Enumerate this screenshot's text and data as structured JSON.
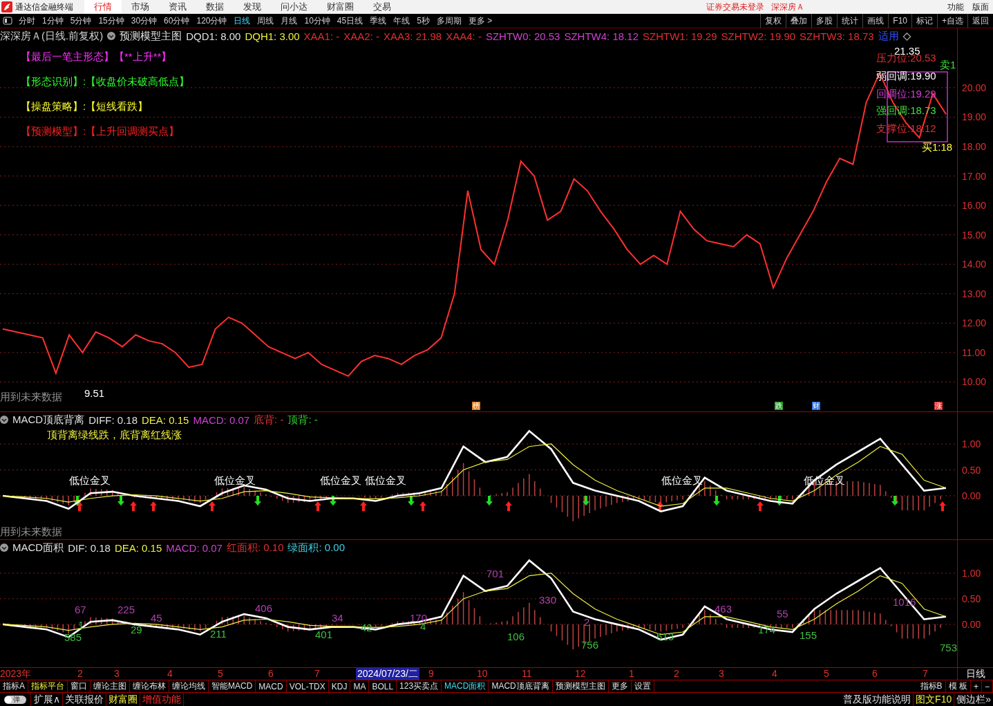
{
  "app": {
    "title": "通达信金融终端",
    "nav": [
      {
        "label": "行情",
        "selected": true
      },
      {
        "label": "市场",
        "selected": false
      },
      {
        "label": "资讯",
        "selected": false
      },
      {
        "label": "数据",
        "selected": false
      },
      {
        "label": "发现",
        "selected": false
      },
      {
        "label": "问小达",
        "selected": false
      },
      {
        "label": "财富圈",
        "selected": false
      },
      {
        "label": "交易",
        "selected": false
      }
    ],
    "login_status": "证券交易未登录",
    "stock": "深深房Ａ",
    "right_menu": [
      "功能",
      "版面"
    ]
  },
  "toolbar": {
    "periods": [
      {
        "label": "分时",
        "selected": false
      },
      {
        "label": "1分钟",
        "selected": false
      },
      {
        "label": "5分钟",
        "selected": false
      },
      {
        "label": "15分钟",
        "selected": false
      },
      {
        "label": "30分钟",
        "selected": false
      },
      {
        "label": "60分钟",
        "selected": false
      },
      {
        "label": "120分钟",
        "selected": false
      },
      {
        "label": "日线",
        "selected": true
      },
      {
        "label": "周线",
        "selected": false
      },
      {
        "label": "月线",
        "selected": false
      },
      {
        "label": "10分钟",
        "selected": false
      },
      {
        "label": "45日线",
        "selected": false
      },
      {
        "label": "季线",
        "selected": false
      },
      {
        "label": "年线",
        "selected": false
      },
      {
        "label": "5秒",
        "selected": false
      },
      {
        "label": "多周期",
        "selected": false
      },
      {
        "label": "更多 >",
        "selected": false
      }
    ],
    "actions": [
      "复权",
      "叠加",
      "多股",
      "统计",
      "画线",
      "F10",
      "标记",
      "+自选",
      "返回"
    ]
  },
  "price_panel": {
    "header": [
      {
        "text": "深深房Ａ(日线.前复权)",
        "color": "#d0d0d0"
      },
      {
        "text": "预测模型主图",
        "color": "#e0e0e0"
      },
      {
        "text": "DQD1: 8.00",
        "color": "#e0e0e0"
      },
      {
        "text": "DQH1: 3.00",
        "color": "#f0f040"
      },
      {
        "text": "XAA1: -",
        "color": "#e03030"
      },
      {
        "text": "XAA2: -",
        "color": "#e03030"
      },
      {
        "text": "XAA3: 21.98",
        "color": "#e03030"
      },
      {
        "text": "XAA4: -",
        "color": "#e03030"
      },
      {
        "text": "SZHTW0: 20.53",
        "color": "#d040d0"
      },
      {
        "text": "SZHTW4: 18.12",
        "color": "#d040d0"
      },
      {
        "text": "SZHTW1: 19.29",
        "color": "#e03030"
      },
      {
        "text": "SZHTW2: 19.90",
        "color": "#e03030"
      },
      {
        "text": "SZHTW3: 18.73",
        "color": "#e03030"
      },
      {
        "text": "适用",
        "color": "#3050ff"
      }
    ],
    "header_glyph": "◇",
    "signals": [
      {
        "text": "【最后一笔主形态】【**上升**】",
        "color": "#ff30ff"
      },
      {
        "text": "【形态识别】:【收盘价未破高低点】",
        "color": "#30ff30"
      },
      {
        "text": "【操盘策略】:【短线看跌】",
        "color": "#ffff30"
      },
      {
        "text": "【预测模型】:【上升回调测买点】",
        "color": "#ff2020"
      }
    ],
    "levels": [
      {
        "text": "压力位:20.53",
        "color": "#e03030"
      },
      {
        "text": "弱回调:19.90",
        "color": "#ffffff"
      },
      {
        "text": "回调位:19.29",
        "color": "#d040d0"
      },
      {
        "text": "强回调:18.73",
        "color": "#40e040"
      },
      {
        "text": "支撑位:18.12",
        "color": "#e03030"
      }
    ],
    "high_mark": "21.35",
    "low_mark": "9.51",
    "sell_mark": "卖1",
    "buy_mark": "买1:18",
    "future_note": "用到未来数据",
    "events": [
      {
        "text": "榜",
        "color": "#e08020"
      },
      {
        "text": "跌",
        "color": "#30a030"
      },
      {
        "text": "财",
        "color": "#3070e0"
      },
      {
        "text": "涨",
        "color": "#e03030"
      }
    ],
    "chart_data": {
      "type": "line",
      "grid": true,
      "ylim": [
        9,
        21.5
      ],
      "yticks": [
        {
          "value": 10,
          "label": "10.00"
        },
        {
          "value": 11,
          "label": "11.00"
        },
        {
          "value": 12,
          "label": "12.00"
        },
        {
          "value": 13,
          "label": "13.00"
        },
        {
          "value": 14,
          "label": "14.00"
        },
        {
          "value": 15,
          "label": "15.00"
        },
        {
          "value": 16,
          "label": "16.00"
        },
        {
          "value": 17,
          "label": "17.00"
        },
        {
          "value": 18,
          "label": "18.00"
        },
        {
          "value": 19,
          "label": "19.00"
        },
        {
          "value": 20,
          "label": "20.00"
        }
      ],
      "series": [
        {
          "color": "#ff3030",
          "values": [
            11.8,
            11.7,
            11.6,
            11.5,
            10.3,
            11.6,
            11.0,
            11.7,
            11.5,
            11.2,
            11.6,
            11.4,
            11.3,
            11.0,
            10.5,
            10.6,
            11.8,
            12.2,
            12.0,
            11.6,
            11.2,
            11.0,
            10.8,
            11.0,
            10.6,
            10.4,
            10.2,
            10.7,
            10.9,
            10.8,
            10.6,
            10.9,
            11.1,
            11.5,
            13.0,
            16.5,
            14.5,
            14.0,
            15.5,
            17.5,
            17.0,
            15.5,
            15.8,
            16.9,
            16.5,
            15.8,
            15.2,
            14.5,
            14.0,
            14.3,
            14.0,
            15.8,
            15.2,
            14.8,
            14.7,
            14.6,
            15.0,
            14.7,
            13.2,
            14.2,
            15.0,
            15.8,
            16.8,
            17.6,
            17.4,
            19.5,
            20.5,
            19.5,
            18.8,
            18.3,
            19.8,
            19.1
          ]
        }
      ]
    }
  },
  "macd_panel": {
    "header": [
      {
        "text": "MACD顶底背离",
        "color": "#e0e0e0"
      },
      {
        "text": "DIFF: 0.18",
        "color": "#e0e0e0"
      },
      {
        "text": "DEA: 0.15",
        "color": "#f0f040"
      },
      {
        "text": "MACD: 0.07",
        "color": "#d040d0"
      },
      {
        "text": "底背: -",
        "color": "#e03030"
      },
      {
        "text": "顶背: -",
        "color": "#30d030"
      }
    ],
    "note": "顶背离绿线跌，底背离红线涨",
    "crosses": [
      "低位金叉",
      "低位金叉",
      "低位金叉",
      "低位金叉",
      "低位金叉",
      "低位金叉"
    ],
    "future_note": "用到未来数据",
    "chart_data": {
      "type": "line",
      "grid": true,
      "ylim": [
        -0.84,
        1.32
      ],
      "yticks": [
        {
          "value": 0,
          "label": "0.00"
        },
        {
          "value": 0.5,
          "label": "0.50"
        },
        {
          "value": 1,
          "label": "1.00"
        }
      ],
      "series": [
        {
          "color": "#ffffff",
          "values": [
            0.0,
            -0.05,
            -0.1,
            -0.25,
            0.05,
            0.08,
            0.0,
            -0.05,
            -0.1,
            -0.2,
            0.05,
            0.2,
            0.12,
            -0.05,
            -0.1,
            -0.05,
            -0.05,
            -0.1,
            0.0,
            0.05,
            0.15,
            0.95,
            0.65,
            0.75,
            1.25,
            0.9,
            0.25,
            0.1,
            0.0,
            -0.1,
            -0.3,
            -0.2,
            0.35,
            0.1,
            0.0,
            -0.1,
            -0.15,
            0.3,
            0.6,
            0.85,
            1.1,
            0.6,
            0.1,
            0.15
          ]
        },
        {
          "color": "#f0f040",
          "values": [
            0.0,
            -0.02,
            -0.05,
            -0.12,
            -0.05,
            0.0,
            0.02,
            0.0,
            -0.05,
            -0.1,
            -0.05,
            0.08,
            0.1,
            0.05,
            -0.02,
            -0.04,
            -0.05,
            -0.06,
            -0.04,
            0.0,
            0.08,
            0.5,
            0.65,
            0.7,
            0.95,
            1.0,
            0.6,
            0.3,
            0.1,
            -0.05,
            -0.2,
            -0.15,
            0.15,
            0.15,
            0.05,
            -0.05,
            -0.1,
            0.1,
            0.4,
            0.65,
            0.95,
            0.8,
            0.3,
            0.15
          ]
        }
      ]
    }
  },
  "area_panel": {
    "header": [
      {
        "text": "MACD面积",
        "color": "#e0e0e0"
      },
      {
        "text": "DIF: 0.18",
        "color": "#e0e0e0"
      },
      {
        "text": "DEA: 0.15",
        "color": "#f0f040"
      },
      {
        "text": "MACD: 0.07",
        "color": "#d040d0"
      },
      {
        "text": "红面积: 0.10",
        "color": "#e03030"
      },
      {
        "text": "绿面积: 0.00",
        "color": "#40d0e0"
      }
    ],
    "area_labels": [
      {
        "text": "67",
        "color": "#b040b0"
      },
      {
        "text": "225",
        "color": "#b040b0"
      },
      {
        "text": "45",
        "color": "#b040b0"
      },
      {
        "text": "406",
        "color": "#b040b0"
      },
      {
        "text": "34",
        "color": "#b040b0"
      },
      {
        "text": "170",
        "color": "#b040b0"
      },
      {
        "text": "701",
        "color": "#b040b0"
      },
      {
        "text": "330",
        "color": "#b040b0"
      },
      {
        "text": "2",
        "color": "#b040b0"
      },
      {
        "text": "463",
        "color": "#b040b0"
      },
      {
        "text": "55",
        "color": "#b040b0"
      },
      {
        "text": "1016",
        "color": "#b040b0"
      },
      {
        "text": "1",
        "color": "#40c040"
      },
      {
        "text": "585",
        "color": "#40c040"
      },
      {
        "text": "29",
        "color": "#40c040"
      },
      {
        "text": "211",
        "color": "#40c040"
      },
      {
        "text": "401",
        "color": "#40c040"
      },
      {
        "text": "42",
        "color": "#40c040"
      },
      {
        "text": "4",
        "color": "#40c040"
      },
      {
        "text": "106",
        "color": "#40c040"
      },
      {
        "text": "756",
        "color": "#40c040"
      },
      {
        "text": "513",
        "color": "#40c040"
      },
      {
        "text": "174",
        "color": "#40c040"
      },
      {
        "text": "155",
        "color": "#40c040"
      },
      {
        "text": "753",
        "color": "#40c040"
      }
    ],
    "chart_data": {
      "type": "line",
      "grid": true,
      "ylim": [
        -0.84,
        1.35
      ],
      "yticks": [
        {
          "value": 0,
          "label": "0.00"
        },
        {
          "value": 0.5,
          "label": "0.50"
        },
        {
          "value": 1,
          "label": "1.00"
        }
      ],
      "series": [
        {
          "color": "#ffffff",
          "values": [
            0.0,
            -0.05,
            -0.1,
            -0.25,
            0.05,
            0.08,
            0.0,
            -0.05,
            -0.1,
            -0.2,
            0.05,
            0.2,
            0.12,
            -0.05,
            -0.1,
            -0.05,
            -0.05,
            -0.1,
            0.0,
            0.05,
            0.15,
            0.95,
            0.65,
            0.75,
            1.25,
            0.9,
            0.25,
            0.1,
            0.0,
            -0.1,
            -0.3,
            -0.2,
            0.35,
            0.1,
            0.0,
            -0.1,
            -0.15,
            0.3,
            0.6,
            0.85,
            1.1,
            0.6,
            0.1,
            0.15
          ]
        },
        {
          "color": "#f0f040",
          "values": [
            0.0,
            -0.02,
            -0.05,
            -0.12,
            -0.05,
            0.0,
            0.02,
            0.0,
            -0.05,
            -0.1,
            -0.05,
            0.08,
            0.1,
            0.05,
            -0.02,
            -0.04,
            -0.05,
            -0.06,
            -0.04,
            0.0,
            0.08,
            0.5,
            0.65,
            0.7,
            0.95,
            1.0,
            0.6,
            0.3,
            0.1,
            -0.05,
            -0.2,
            -0.15,
            0.15,
            0.15,
            0.05,
            -0.05,
            -0.1,
            0.1,
            0.4,
            0.65,
            0.95,
            0.8,
            0.3,
            0.15
          ]
        }
      ]
    }
  },
  "x_axis": {
    "labels": [
      "2023年",
      "2",
      "3",
      "4",
      "5",
      "6",
      "7",
      "9",
      "10",
      "11",
      "12",
      "1",
      "2",
      "3",
      "4",
      "5",
      "6",
      "7"
    ],
    "cursor_date": "2024/07/23/二",
    "period": "日线"
  },
  "indicator_bar": {
    "prefix": [
      {
        "label": "指标A",
        "highlight": false
      },
      {
        "label": "指标平台",
        "highlight": true
      }
    ],
    "tabs": [
      {
        "label": "窗口",
        "selected": false
      },
      {
        "label": "缠论主图",
        "selected": false
      },
      {
        "label": "缠论布林",
        "selected": false
      },
      {
        "label": "缠论均线",
        "selected": false
      },
      {
        "label": "智能MACD",
        "selected": false
      },
      {
        "label": "MACD",
        "selected": false
      },
      {
        "label": "VOL-TDX",
        "selected": false
      },
      {
        "label": "KDJ",
        "selected": false
      },
      {
        "label": "MA",
        "selected": false
      },
      {
        "label": "BOLL",
        "selected": false
      },
      {
        "label": "123买卖点",
        "selected": false
      },
      {
        "label": "MACD面积",
        "selected": true
      },
      {
        "label": "MACD顶底背离",
        "selected": false
      },
      {
        "label": "预测模型主图",
        "selected": false
      },
      {
        "label": "更多",
        "selected": false
      },
      {
        "label": "设置",
        "selected": false
      }
    ],
    "right": [
      "指标B",
      "模 板",
      "+",
      "−"
    ]
  },
  "status_bar": {
    "toggle": {
      "label": "弹",
      "on": false
    },
    "left": [
      {
        "text": "扩展∧",
        "color": "#e0e0e0"
      },
      {
        "text": "关联报价",
        "color": "#e0e0e0"
      },
      {
        "text": "财富圈",
        "color": "#f0f040"
      },
      {
        "text": "增值功能",
        "color": "#ff3030"
      }
    ],
    "right": [
      {
        "text": "普及版功能说明",
        "color": "#e0e0e0"
      },
      {
        "text": "图文F10",
        "color": "#f0f040"
      },
      {
        "text": "侧边栏»",
        "color": "#e0e0e0"
      }
    ]
  }
}
